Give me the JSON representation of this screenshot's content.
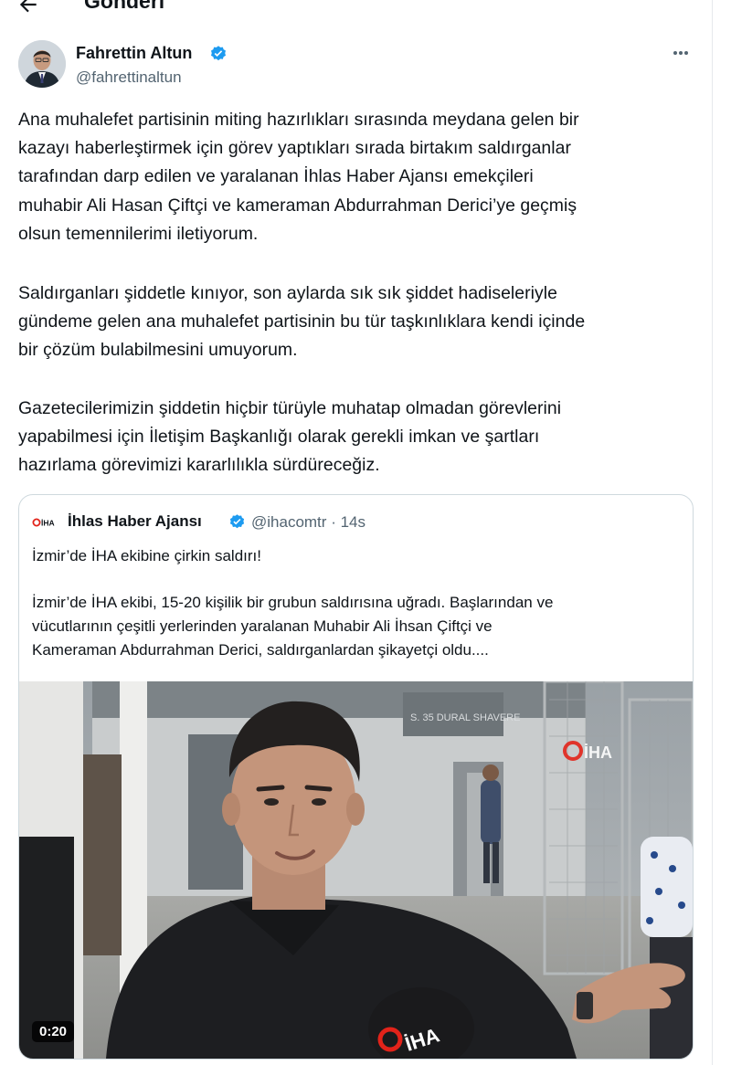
{
  "header": {
    "title": "Gönderi",
    "back_icon": "arrow-left-icon"
  },
  "tweet": {
    "author_name": "Fahrettin Altun",
    "author_handle": "@fahrettinaltun",
    "more_icon": "more-horizontal-icon",
    "paragraphs": [
      [
        "Ana muhalefet partisinin miting hazırlıkları sırasında meydana gelen bir",
        "kazayı haberleştirmek için görev yaptıkları sırada birtakım saldırganlar",
        "tarafından darp edilen ve yaralanan İhlas Haber Ajansı emekçileri",
        "muhabir Ali Hasan Çiftçi ve kameraman Abdurrahman Derici’ye geçmiş",
        "olsun temennilerimi iletiyorum."
      ],
      [
        "Saldırganları şiddetle kınıyor, son aylarda sık sık şiddet hadiseleriyle",
        "gündeme gelen ana muhalefet partisinin bu tür taşkınlıklara kendi içinde",
        "bir çözüm bulabilmesini umuyorum."
      ],
      [
        "Gazetecilerimizin şiddetin hiçbir türüyle muhatap olmadan görevlerini",
        "yapabilmesi için İletişim Başkanlığı olarak gerekli imkan ve şartları",
        "hazırlama görevimizi kararlılıkla sürdüreceğiz."
      ]
    ]
  },
  "quoted": {
    "logo_text": "İHA",
    "author_name": "İhlas Haber Ajansı",
    "author_handle": "@ihacomtr",
    "separator": "·",
    "time": "14s",
    "headline": "İzmir’de İHA ekibine çirkin saldırı!",
    "body_lines": [
      "İzmir’de İHA ekibi, 15-20 kişilik bir grubun saldırısına uğradı. Başlarından ve",
      "vücutlarının çeşitli yerlerinden yaralanan Muhabir Ali İhsan Çiftçi ve",
      "Kameraman Abdurrahman Derici, saldırganlardan şikayetçi oldu...."
    ],
    "video": {
      "duration": "0:20",
      "watermark": "İHA",
      "mic_label": "İHA",
      "sign_text": "S. 35 DURAL SHAVERE"
    }
  },
  "colors": {
    "text": "#0f1419",
    "secondary": "#536471",
    "verified": "#1d9bf0",
    "border": "#cfd9de",
    "brand_red": "#e2231a"
  }
}
